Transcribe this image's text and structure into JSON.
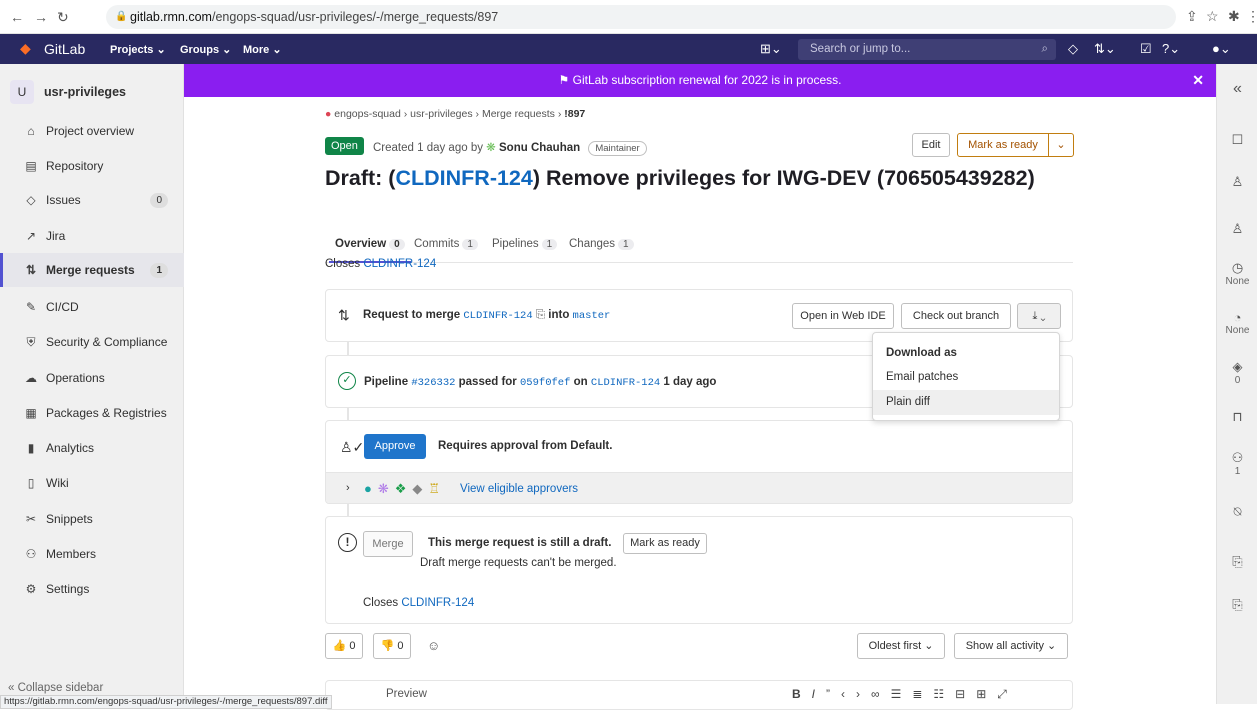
{
  "browser": {
    "url_domain": "gitlab.rmn.com",
    "url_path": "/engops-squad/usr-privileges/-/merge_requests/897",
    "status_url": "https://gitlab.rmn.com/engops-squad/usr-privileges/-/merge_requests/897.diff"
  },
  "topnav": {
    "brand": "GitLab",
    "menus": [
      "Projects ⌄",
      "Groups ⌄",
      "More ⌄"
    ],
    "search_placeholder": "Search or jump to..."
  },
  "sidebar": {
    "avatar_letter": "U",
    "project_name": "usr-privileges",
    "items": [
      {
        "label": "Project overview",
        "icon": "⌂"
      },
      {
        "label": "Repository",
        "icon": "▤"
      },
      {
        "label": "Issues",
        "icon": "◇",
        "count": "0"
      },
      {
        "label": "Jira",
        "icon": "↗"
      },
      {
        "label": "Merge requests",
        "icon": "⇅",
        "count": "1"
      },
      {
        "label": "CI/CD",
        "icon": "✎"
      },
      {
        "label": "Security & Compliance",
        "icon": "⛨"
      },
      {
        "label": "Operations",
        "icon": "☁"
      },
      {
        "label": "Packages & Registries",
        "icon": "▦"
      },
      {
        "label": "Analytics",
        "icon": "▮"
      },
      {
        "label": "Wiki",
        "icon": "▯"
      },
      {
        "label": "Snippets",
        "icon": "✂"
      },
      {
        "label": "Members",
        "icon": "⚇"
      },
      {
        "label": "Settings",
        "icon": "⚙"
      }
    ],
    "collapse_label": "Collapse sidebar"
  },
  "banner": {
    "text": "GitLab subscription renewal for 2022 is in process."
  },
  "breadcrumb": [
    "engops-squad",
    "usr-privileges",
    "Merge requests",
    "!897"
  ],
  "mr": {
    "status": "Open",
    "created_prefix": "Created 1 day ago by",
    "author": "Sonu Chauhan",
    "author_role": "Maintainer",
    "edit_label": "Edit",
    "mark_ready_label": "Mark as ready",
    "title_prefix": "Draft: (",
    "title_link": "CLDINFR-124",
    "title_suffix": ") Remove privileges for IWG-DEV (706505439282)",
    "tabs": [
      {
        "label": "Overview",
        "count": "0"
      },
      {
        "label": "Commits",
        "count": "1"
      },
      {
        "label": "Pipelines",
        "count": "1"
      },
      {
        "label": "Changes",
        "count": "1"
      }
    ],
    "closes_prefix": "Closes",
    "closes_issue": "CLDINFR-124"
  },
  "merge_widget": {
    "request_to_merge": "Request to merge",
    "source_branch": "CLDINFR-124",
    "into": "into",
    "target_branch": "master",
    "open_ide": "Open in Web IDE",
    "checkout": "Check out branch",
    "download_menu": {
      "header": "Download as",
      "options": [
        "Email patches",
        "Plain diff"
      ]
    }
  },
  "pipeline": {
    "label": "Pipeline",
    "id": "#326332",
    "passed_for": "passed for",
    "commit": "059f0fef",
    "on": "on",
    "branch": "CLDINFR-124",
    "time": "1 day ago"
  },
  "approval": {
    "approve_label": "Approve",
    "requirement": "Requires approval from Default.",
    "view_approvers": "View eligible approvers"
  },
  "draft_widget": {
    "merge_label": "Merge",
    "message": "This merge request is still a draft.",
    "mark_ready_label": "Mark as ready",
    "sub_message": "Draft merge requests can't be merged.",
    "closes_prefix": "Closes",
    "closes_issue": "CLDINFR-124"
  },
  "reactions": {
    "thumbs_up": "0",
    "thumbs_down": "0"
  },
  "sort": {
    "order": "Oldest first",
    "filter": "Show all activity"
  },
  "editor": {
    "preview_label": "Preview"
  },
  "right_sidebar": {
    "assignee": "None",
    "milestone": "None",
    "labels": "0",
    "participants": "1"
  },
  "colors": {
    "topnav": "#292961",
    "banner": "#8a1ef0",
    "open_badge": "#108548",
    "link": "#1068bf",
    "approve": "#1f75cb"
  }
}
